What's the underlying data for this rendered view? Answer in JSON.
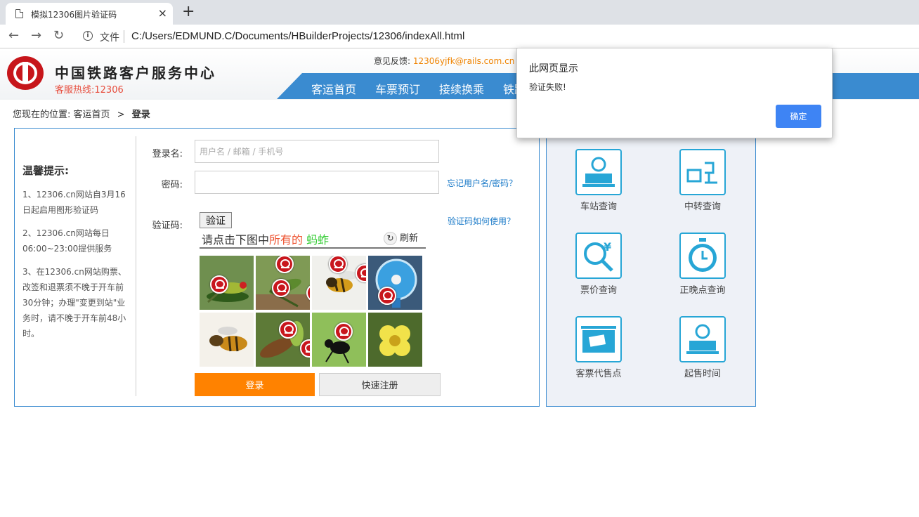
{
  "browser": {
    "tab_title": "模拟12306图片验证码",
    "close_tab": "×",
    "new_tab": "+",
    "back": "←",
    "forward": "→",
    "reload": "↻",
    "info": "i",
    "file_label": "文件",
    "url": "C:/Users/EDMUND.C/Documents/HBuilderProjects/12306/indexAll.html"
  },
  "header": {
    "brand": "中国铁路客户服务中心",
    "hotline": "客服热线:12306",
    "feedback_label": "意见反馈: ",
    "feedback_email": "12306yjfk@rails.com.cn",
    "nav": [
      "客运首页",
      "车票预订",
      "接续换乘",
      "铁路"
    ]
  },
  "breadcrumb": {
    "prefix": "您现在的位置: ",
    "home": "客运首页",
    "sep": ">",
    "current": "登录"
  },
  "tips": {
    "title": "温馨提示:",
    "items": [
      "1、12306.cn网站自3月16日起启用图形验证码",
      "2、12306.cn网站每日06:00~23:00提供服务",
      "3、在12306.cn网站购票、改签和退票须不晚于开车前30分钟；办理\"变更到站\"业务时，请不晚于开车前48小时。"
    ]
  },
  "form": {
    "username_label": "登录名:",
    "username_placeholder": "用户名 / 邮箱 / 手机号",
    "password_label": "密码:",
    "forgot": "忘记用户名/密码？",
    "captcha_label": "验证码:",
    "captcha_help": "验证码如何使用？",
    "verify_button": "验证",
    "captcha_prompt_a": "请点击下图中",
    "captcha_prompt_b": "所有的",
    "captcha_prompt_c": " 蚂蚱",
    "refresh_icon": "↻",
    "refresh": "刷新",
    "login_button": "登录",
    "register_button": "快速注册"
  },
  "captcha_images": [
    {
      "subject": "grasshopper",
      "marked": true,
      "bg": "#6f8f4f"
    },
    {
      "subject": "grasshopper",
      "marked": true,
      "bg": "#7f9a55"
    },
    {
      "subject": "bee",
      "marked": true,
      "bg": "#f0f0ec"
    },
    {
      "subject": "fan",
      "marked": true,
      "bg": "#3b5a7a"
    },
    {
      "subject": "bee",
      "marked": false,
      "bg": "#f4f1ea"
    },
    {
      "subject": "grasshopper",
      "marked": true,
      "bg": "#5d7a37"
    },
    {
      "subject": "ant",
      "marked": true,
      "bg": "#8fbf5a"
    },
    {
      "subject": "flower",
      "marked": false,
      "bg": "#4d6a2c"
    }
  ],
  "services": [
    {
      "label": "车站查询",
      "icon": "station-icon"
    },
    {
      "label": "中转查询",
      "icon": "transfer-icon"
    },
    {
      "label": "票价查询",
      "icon": "fare-icon"
    },
    {
      "label": "正晚点查询",
      "icon": "timer-icon"
    },
    {
      "label": "客票代售点",
      "icon": "ticket-agent-icon"
    },
    {
      "label": "起售时间",
      "icon": "sale-time-icon"
    }
  ],
  "dialog": {
    "title": "此网页显示",
    "message": "验证失败!",
    "ok": "确定"
  },
  "colors": {
    "accent": "#3a8bd0",
    "login": "#ff8200",
    "brand_red": "#c7161b",
    "dialog_button": "#3e84f4"
  }
}
